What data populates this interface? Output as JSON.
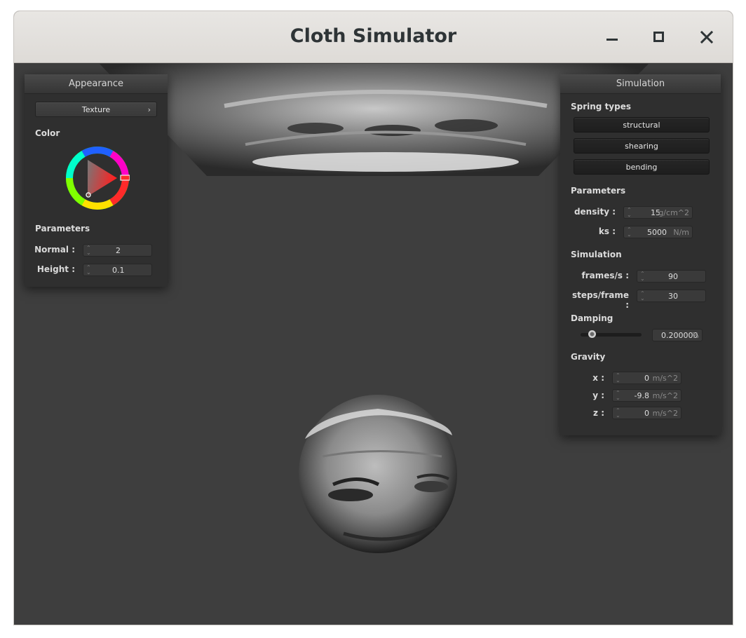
{
  "window": {
    "title": "Cloth Simulator",
    "controls": {
      "minimize_icon": "minimize-icon",
      "maximize_icon": "maximize-icon",
      "close_icon": "close-icon"
    }
  },
  "appearance": {
    "header": "Appearance",
    "texture_button": "Texture",
    "color_label": "Color",
    "parameters_label": "Parameters",
    "normal": {
      "label": "Normal :",
      "value": "2"
    },
    "height": {
      "label": "Height :",
      "value": "0.1"
    }
  },
  "simulation": {
    "header": "Simulation",
    "spring_types_label": "Spring types",
    "spring_buttons": [
      "structural",
      "shearing",
      "bending"
    ],
    "parameters_label": "Parameters",
    "density": {
      "label": "density :",
      "value": "15",
      "unit": "g/cm^2"
    },
    "ks": {
      "label": "ks :",
      "value": "5000",
      "unit": "N/m"
    },
    "simulation_label": "Simulation",
    "frames_per_s": {
      "label": "frames/s :",
      "value": "90"
    },
    "steps_per_frame": {
      "label": "steps/frame :",
      "value": "30"
    },
    "damping_label": "Damping",
    "damping": {
      "value": "0.200000",
      "unit": "%",
      "slider_fraction": 0.2
    },
    "gravity_label": "Gravity",
    "gravity": {
      "x": {
        "label": "x :",
        "value": "0",
        "unit": "m/s^2"
      },
      "y": {
        "label": "y :",
        "value": "-9.8",
        "unit": "m/s^2"
      },
      "z": {
        "label": "z :",
        "value": "0",
        "unit": "m/s^2"
      }
    }
  },
  "colors": {
    "viewport_bg": "#3e3e3e",
    "panel_bg": "#2f2f2f",
    "picker_hue": "#ff0000"
  }
}
